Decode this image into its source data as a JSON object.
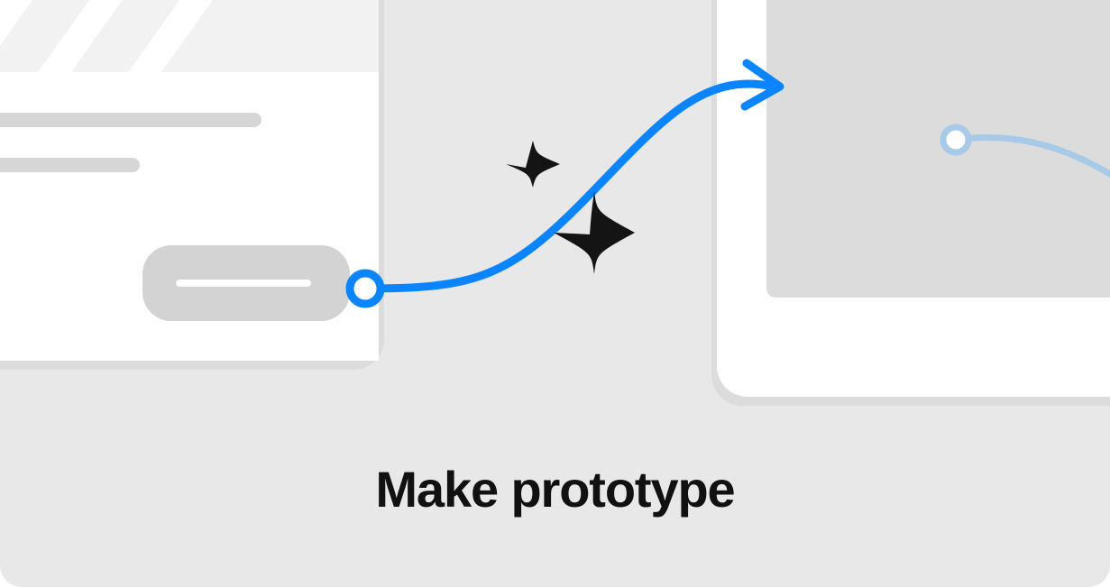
{
  "card": {
    "title": "Make prototype"
  },
  "colors": {
    "accent": "#0A84FF",
    "accentLight": "#A7CAE8",
    "panel": "#FFFFFF",
    "panelShade": "#DADADA",
    "line": "#D6D6D6",
    "sparkle": "#141414",
    "background": "#E8E8E8"
  },
  "icons": {
    "sparkle_top": "sparkle-icon",
    "sparkle_bottom": "sparkle-icon",
    "arrow": "connection-arrow-icon",
    "hotspot": "hotspot-handle-icon",
    "curve_node": "bezier-node-icon"
  }
}
